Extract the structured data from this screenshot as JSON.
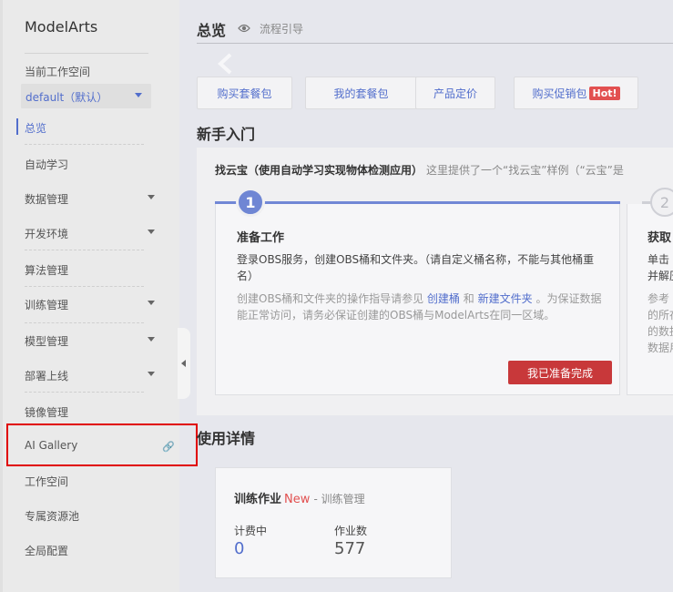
{
  "sidebar": {
    "brand": "ModelArts",
    "workspace_label": "当前工作空间",
    "workspace_value": "default（默认）",
    "items": [
      {
        "label": "总览",
        "active": true
      },
      {
        "label": "自动学习"
      },
      {
        "label": "数据管理",
        "has_submenu": true
      },
      {
        "label": "开发环境",
        "has_submenu": true
      },
      {
        "label": "算法管理"
      },
      {
        "label": "训练管理",
        "has_submenu": true
      },
      {
        "label": "模型管理",
        "has_submenu": true
      },
      {
        "label": "部署上线",
        "has_submenu": true
      },
      {
        "label": "镜像管理"
      },
      {
        "label": "AI Gallery",
        "external_link": true
      },
      {
        "label": "工作空间"
      },
      {
        "label": "专属资源池"
      },
      {
        "label": "全局配置"
      }
    ]
  },
  "header": {
    "title": "总览",
    "guide": "流程引导"
  },
  "quick_buttons": {
    "buy_package": "购买套餐包",
    "my_package": "我的套餐包",
    "pricing": "产品定价",
    "promo": "购买促销包",
    "hot": "Hot!"
  },
  "intro": {
    "section_title": "新手入门",
    "case_title": "找云宝（使用自动学习实现物体检测应用）",
    "case_desc": "这里提供了一个“找云宝”样例（“云宝”是",
    "step1": {
      "number": "1",
      "title": "准备工作",
      "desc": "登录OBS服务，创建OBS桶和文件夹。（请自定义桶名称，不能与其他桶重名）",
      "note_prefix": "创建OBS桶和文件夹的操作指导请参见",
      "link1": "创建桶",
      "and": "和",
      "link2": "新建文件夹",
      "note_suffix": "。为保证数据能正常访问，请务必保证创建的OBS桶与ModelArts在同一区域。",
      "done_button": "我已准备完成"
    },
    "step2": {
      "number": "2",
      "title": "获取",
      "desc_line1": "单击",
      "desc_line2": "并解压",
      "note_line1": "参考",
      "note_line2": "的所在",
      "note_line3": "的数据",
      "note_line4": "数据用"
    }
  },
  "usage": {
    "section_title": "使用详情",
    "card_title": "训练作业",
    "new_badge": "New",
    "card_sub": "- 训练管理",
    "billing_label": "计费中",
    "billing_value": "0",
    "jobs_label": "作业数",
    "jobs_value": "577"
  },
  "colors": {
    "accent": "#526ecc",
    "danger": "#c8383a",
    "hot": "#e25050"
  }
}
